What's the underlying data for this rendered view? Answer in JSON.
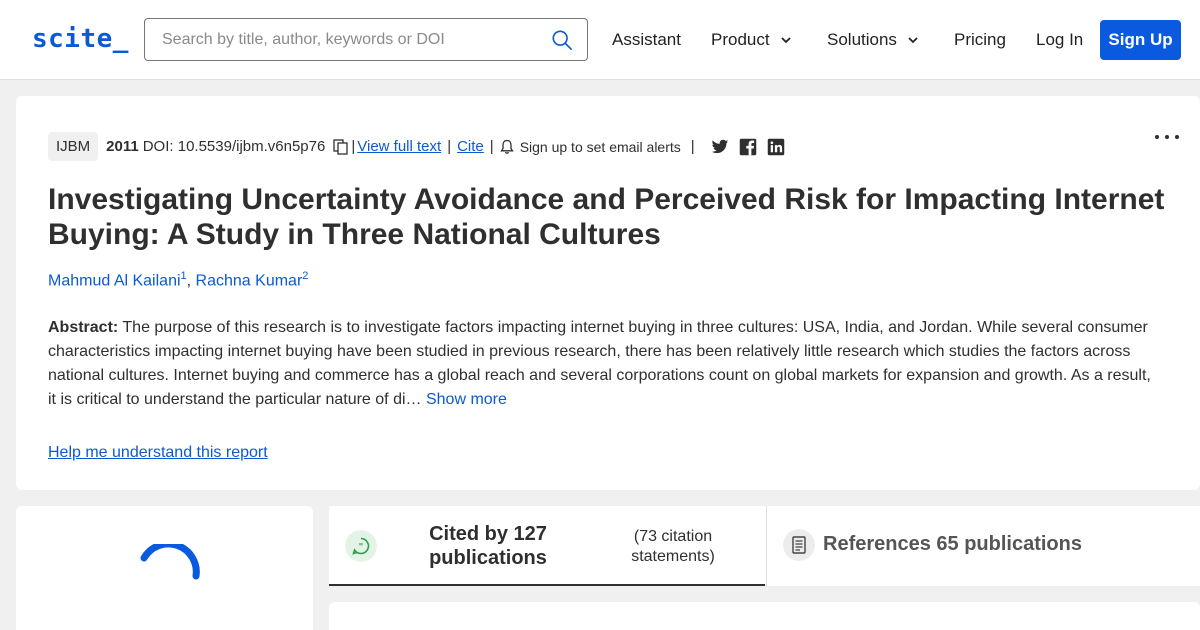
{
  "header": {
    "logo": "scite_",
    "search": {
      "placeholder": "Search by title, author, keywords or DOI",
      "value": ""
    },
    "nav": {
      "assistant": "Assistant",
      "product": "Product",
      "solutions": "Solutions",
      "pricing": "Pricing",
      "login": "Log In",
      "signup": "Sign Up"
    }
  },
  "paper": {
    "journal": "IJBM",
    "year": "2011",
    "doi": "DOI: 10.5539/ijbm.v6n5p76",
    "view_full_text": "View full text",
    "cite": "Cite",
    "alerts": "Sign up to set email alerts",
    "separator": "|",
    "title": "Investigating Uncertainty Avoidance and Perceived Risk for Impacting Internet Buying: A Study in Three National Cultures",
    "authors": [
      {
        "name": "Mahmud Al Kailani",
        "sup": "1"
      },
      {
        "name": "Rachna Kumar",
        "sup": "2"
      }
    ],
    "author_separator": ",",
    "abstract_label": "Abstract:",
    "abstract_text": "The purpose of this research is to investigate factors impacting internet buying in three cultures: USA, India, and Jordan. While several consumer characteristics impacting internet buying have been studied in previous research, there has been relatively little research which studies the factors across national cultures. Internet buying and commerce has a global reach and several corporations count on global markets for expansion and growth. As a result, it is critical to understand the particular nature of di…",
    "show_more": "Show more",
    "help_link": "Help me understand this report"
  },
  "tabs": {
    "cited_by": "Cited by 127 publications",
    "citation_statements": "(73 citation statements)",
    "references": "References 65 publications"
  },
  "colors": {
    "brand": "#0a5ad4",
    "signup_bg": "#0a5ae0",
    "cited_icon_bg": "#e3f4e6",
    "cited_icon": "#2e9e4a"
  },
  "icons": {
    "search": "search-icon",
    "copy": "copy-icon",
    "bell": "bell-icon",
    "twitter": "twitter-icon",
    "facebook": "facebook-icon",
    "linkedin": "linkedin-icon",
    "more": "more-options-icon",
    "chat": "chat-bubble-icon",
    "document": "document-icon",
    "loading": "loading-spinner"
  }
}
